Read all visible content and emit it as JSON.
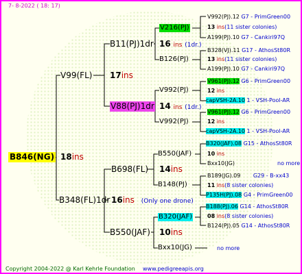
{
  "header": {
    "date": "7-  8-2022 ( 18:  17)"
  },
  "footer": {
    "copyright": "Copyright 2004-2022 @ Karl Kehrle Foundation",
    "site": "www.pedigreeapis.org"
  },
  "root": {
    "id": "B846(NG)",
    "num": "18",
    "ins": "ins"
  },
  "gen1": {
    "top": {
      "id": "V99(FL)",
      "num": "17",
      "ins": "ins"
    },
    "bottom": {
      "id": "B348(FL)1dr",
      "num": "16",
      "ins": "ins",
      "note": "(Only one drone)"
    }
  },
  "gen2": {
    "a": {
      "id": "B11(PJ)1dr",
      "num": "16",
      "ins": "ins",
      "note": "(1dr.)"
    },
    "b": {
      "id": "V88(PJ)1dr",
      "num": "14",
      "ins": "ins",
      "note": "(1dr.)"
    },
    "c": {
      "id": "B698(FL)",
      "num": "14",
      "ins": "ins"
    },
    "d": {
      "id": "B550(JAF)",
      "num": "10",
      "ins": "ins"
    }
  },
  "gen3": {
    "a1": {
      "id": "V216(PJ)"
    },
    "a2": {
      "id": "B126(PJ)"
    },
    "b1": {
      "id": "V992(PJ)",
      "num": "12",
      "ins": "ins"
    },
    "b2": {
      "id": "V992(PJ)",
      "num": "12",
      "ins": "ins"
    },
    "c1": {
      "id": "B550(JAF)",
      "num": "10",
      "ins": "ins"
    },
    "c2": {
      "id": "B148(PJ)"
    },
    "d1": {
      "id": "B320(JAF)",
      "num": "08",
      "ins": "ins"
    },
    "d2": {
      "id": "Bxx10(JG)",
      "note": "no more"
    }
  },
  "gen4": {
    "r1": {
      "id": "V992(PJ).12",
      "info": "G7 - PrimGreen00"
    },
    "r1b": {
      "num": "13",
      "ins": "ins",
      "note": "(11 sister colonies)"
    },
    "r2": {
      "id": "A199(PJ).10",
      "info": "G7 - Cankiri97Q"
    },
    "r3": {
      "id": "B328(VJ).11",
      "info": "G17 - AthosSt80R"
    },
    "r3b": {
      "num": "13",
      "ins": "ins",
      "note": "(11 sister colonies)"
    },
    "r4": {
      "id": "A199(PJ).10",
      "info": "G7 - Cankiri97Q"
    },
    "r5": {
      "id": "V961(PJ).12",
      "info": "G6 - PrimGreen00"
    },
    "r5b": {
      "num": "12",
      "ins": "ins"
    },
    "r6": {
      "id": "capVSH-2A.10",
      "info": "1 - VSH-Pool-AR"
    },
    "r7": {
      "id": "V961(PJ).12",
      "info": "G6 - PrimGreen00"
    },
    "r7b": {
      "num": "12",
      "ins": "ins"
    },
    "r8": {
      "id": "capVSH-2A.10",
      "info": "1 - VSH-Pool-AR"
    },
    "r9": {
      "id": "B320(JAF).08",
      "info": "G15 - AthosSt80R"
    },
    "r9b": {
      "num": "10",
      "ins": "ins"
    },
    "r10": {
      "id": "Bxx10(JG)",
      "info": "no more"
    },
    "r11": {
      "id": "B189(JG).09",
      "info": "G29 - B-xx43"
    },
    "r11b": {
      "num": "11",
      "ins": "ins",
      "note": "(8 sister colonies)"
    },
    "r12": {
      "id": "P135H(PJ).08",
      "info": "G4 - PrimGreen00"
    },
    "r13": {
      "id": "B188(PJ).06",
      "info": "G14 - AthosSt80R"
    },
    "r13b": {
      "num": "08",
      "ins": "ins",
      "note": "(8 sister colonies)"
    },
    "r14": {
      "id": "B124(PJ).05",
      "info": "G14 - AthosSt80R"
    }
  },
  "colors": {
    "frame": "#ff00ff",
    "root_bg": "#ffff00",
    "highlight_green": "#00dd00",
    "highlight_magenta": "#ee44ee",
    "highlight_cyan": "#00eeee",
    "ins_text": "#c00000",
    "info_text": "#0000cc"
  }
}
